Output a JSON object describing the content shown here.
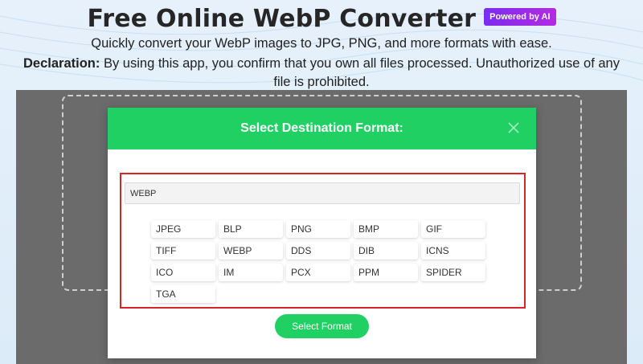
{
  "header": {
    "title": "Free Online WebP Converter",
    "ai_badge": "Powered by AI",
    "subtitle": "Quickly convert your WebP images to JPG, PNG, and more formats with ease.",
    "declaration_label": "Declaration:",
    "declaration_text": " By using this app, you confirm that you own all files processed. Unauthorized use of any file is prohibited."
  },
  "modal": {
    "title": "Select Destination Format:",
    "close_icon": "close-icon",
    "search_value": "WEBP",
    "formats": [
      "JPEG",
      "BLP",
      "PNG",
      "BMP",
      "GIF",
      "TIFF",
      "WEBP",
      "DDS",
      "DIB",
      "ICNS",
      "ICO",
      "IM",
      "PCX",
      "PPM",
      "SPIDER",
      "TGA"
    ],
    "select_button_label": "Select Format"
  },
  "colors": {
    "accent_green": "#20d063",
    "highlight_red": "#d6262c",
    "overlay_gray": "#6b6b6b",
    "badge_purple": "#7b2cf0"
  }
}
